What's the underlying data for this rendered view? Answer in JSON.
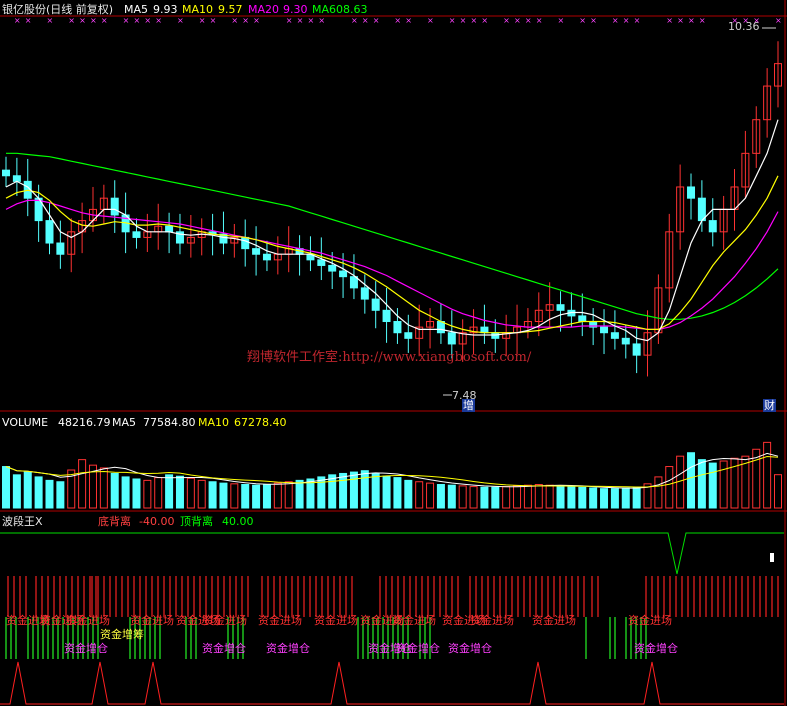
{
  "chart_data": [
    {
      "type": "candlestick",
      "panel": "price",
      "title": "银亿股份(日线 前复权)",
      "indicators": [
        {
          "name": "MA5",
          "value": "9.93",
          "color": "#ffffff"
        },
        {
          "name": "MA10",
          "value": "9.57",
          "color": "#ffff00"
        },
        {
          "name": "MA20",
          "value": "9.30",
          "color": "#ff00ff"
        },
        {
          "name": "MA60",
          "value": "8.63",
          "color": "#00ff00"
        }
      ],
      "annotations": {
        "high": "10.36",
        "low": "7.48",
        "low_marker": "增",
        "right_marker": "财"
      },
      "watermark": "翔博软件工作室:http://www.xiangbosoft.com/",
      "ylim": [
        7.3,
        10.6
      ],
      "closes": [
        9.3,
        9.25,
        9.1,
        8.9,
        8.7,
        8.6,
        8.8,
        8.9,
        9.0,
        9.1,
        8.95,
        8.8,
        8.75,
        8.8,
        8.85,
        8.8,
        8.7,
        8.75,
        8.8,
        8.78,
        8.7,
        8.75,
        8.65,
        8.6,
        8.55,
        8.6,
        8.65,
        8.6,
        8.55,
        8.5,
        8.45,
        8.4,
        8.3,
        8.2,
        8.1,
        8.0,
        7.9,
        7.85,
        7.95,
        8.0,
        7.9,
        7.8,
        7.9,
        7.95,
        7.9,
        7.85,
        7.9,
        7.95,
        8.0,
        8.1,
        8.15,
        8.1,
        8.05,
        8.0,
        7.95,
        7.9,
        7.85,
        7.8,
        7.7,
        7.9,
        8.3,
        8.8,
        9.2,
        9.1,
        8.9,
        8.8,
        9.0,
        9.2,
        9.5,
        9.8,
        10.1,
        10.3
      ],
      "ma5": [
        9.2,
        9.25,
        9.2,
        9.1,
        8.95,
        8.8,
        8.75,
        8.8,
        8.9,
        9.0,
        9.0,
        8.95,
        8.85,
        8.8,
        8.8,
        8.8,
        8.78,
        8.77,
        8.78,
        8.77,
        8.75,
        8.74,
        8.72,
        8.68,
        8.63,
        8.6,
        8.6,
        8.6,
        8.6,
        8.56,
        8.52,
        8.47,
        8.41,
        8.33,
        8.25,
        8.15,
        8.05,
        7.97,
        7.93,
        7.93,
        7.93,
        7.91,
        7.89,
        7.88,
        7.88,
        7.88,
        7.89,
        7.9,
        7.92,
        7.96,
        8.02,
        8.06,
        8.08,
        8.08,
        8.06,
        8.01,
        7.96,
        7.92,
        7.85,
        7.83,
        7.9,
        8.1,
        8.4,
        8.7,
        8.9,
        9.0,
        9.0,
        9.0,
        9.1,
        9.3,
        9.5,
        9.8
      ],
      "ma10": [
        9.1,
        9.15,
        9.17,
        9.15,
        9.08,
        8.98,
        8.9,
        8.86,
        8.85,
        8.87,
        8.89,
        8.88,
        8.86,
        8.86,
        8.87,
        8.86,
        8.84,
        8.82,
        8.8,
        8.78,
        8.77,
        8.76,
        8.75,
        8.73,
        8.7,
        8.67,
        8.65,
        8.63,
        8.61,
        8.58,
        8.55,
        8.52,
        8.48,
        8.43,
        8.37,
        8.31,
        8.24,
        8.17,
        8.1,
        8.05,
        8.0,
        7.96,
        7.93,
        7.91,
        7.9,
        7.9,
        7.9,
        7.9,
        7.91,
        7.92,
        7.94,
        7.96,
        7.98,
        8.0,
        8.0,
        8.0,
        7.99,
        7.97,
        7.95,
        7.93,
        7.93,
        7.98,
        8.08,
        8.2,
        8.35,
        8.5,
        8.62,
        8.72,
        8.82,
        8.95,
        9.1,
        9.3
      ],
      "ma20": [
        9.0,
        9.05,
        9.08,
        9.08,
        9.06,
        9.03,
        9.0,
        8.97,
        8.95,
        8.94,
        8.93,
        8.92,
        8.91,
        8.9,
        8.89,
        8.88,
        8.87,
        8.85,
        8.83,
        8.81,
        8.79,
        8.77,
        8.75,
        8.73,
        8.71,
        8.69,
        8.67,
        8.65,
        8.63,
        8.61,
        8.58,
        8.55,
        8.52,
        8.49,
        8.45,
        8.41,
        8.36,
        8.31,
        8.26,
        8.21,
        8.16,
        8.11,
        8.07,
        8.04,
        8.01,
        7.99,
        7.97,
        7.96,
        7.95,
        7.95,
        7.95,
        7.95,
        7.95,
        7.96,
        7.96,
        7.96,
        7.96,
        7.95,
        7.94,
        7.93,
        7.93,
        7.95,
        7.99,
        8.05,
        8.12,
        8.2,
        8.3,
        8.4,
        8.52,
        8.65,
        8.8,
        8.98
      ],
      "ma60": [
        9.5,
        9.5,
        9.49,
        9.48,
        9.47,
        9.45,
        9.43,
        9.41,
        9.39,
        9.37,
        9.35,
        9.33,
        9.31,
        9.29,
        9.27,
        9.25,
        9.23,
        9.21,
        9.19,
        9.17,
        9.15,
        9.13,
        9.11,
        9.09,
        9.07,
        9.05,
        9.03,
        9.0,
        8.97,
        8.94,
        8.91,
        8.88,
        8.85,
        8.82,
        8.79,
        8.76,
        8.73,
        8.7,
        8.67,
        8.64,
        8.61,
        8.58,
        8.55,
        8.52,
        8.49,
        8.46,
        8.43,
        8.4,
        8.37,
        8.34,
        8.31,
        8.28,
        8.25,
        8.22,
        8.19,
        8.16,
        8.13,
        8.1,
        8.07,
        8.05,
        8.03,
        8.02,
        8.02,
        8.03,
        8.05,
        8.08,
        8.12,
        8.17,
        8.23,
        8.3,
        8.38,
        8.47
      ]
    },
    {
      "type": "bar",
      "panel": "volume",
      "indicators": [
        {
          "name": "VOLUME",
          "value": "48216.79",
          "color": "#ffffff"
        },
        {
          "name": "MA5",
          "value": "77584.80",
          "color": "#ffffff"
        },
        {
          "name": "MA10",
          "value": "67278.40",
          "color": "#ffff00"
        }
      ],
      "ylim": [
        0,
        110000
      ],
      "values": [
        60000,
        48000,
        52000,
        45000,
        40000,
        38000,
        55000,
        70000,
        62000,
        58000,
        50000,
        45000,
        42000,
        40000,
        44000,
        48000,
        46000,
        43000,
        40000,
        38000,
        36000,
        35000,
        34000,
        33000,
        34000,
        36000,
        38000,
        40000,
        42000,
        45000,
        48000,
        50000,
        52000,
        54000,
        50000,
        46000,
        44000,
        40000,
        38000,
        36000,
        34000,
        33000,
        32000,
        31000,
        30000,
        30000,
        31000,
        32000,
        33000,
        34000,
        33000,
        32000,
        31000,
        30000,
        29000,
        28000,
        28000,
        29000,
        30000,
        35000,
        45000,
        60000,
        75000,
        80000,
        70000,
        65000,
        68000,
        72000,
        75000,
        85000,
        95000,
        48216.79
      ]
    },
    {
      "type": "signal",
      "panel": "indicator",
      "title": "波段王X",
      "indicators": [
        {
          "name": "底背离",
          "value": "-40.00",
          "color": "#ff4040"
        },
        {
          "name": "顶背离",
          "value": "40.00",
          "color": "#00ff00"
        }
      ],
      "red_labels": [
        "资金进场",
        "资金进场",
        "资金进场",
        "资金进场",
        "资金进场",
        "资金进场",
        "资金进场",
        "资金进场",
        "资金进场",
        "资金进场",
        "资金进场",
        "资金进场",
        "资金进场",
        "资金进场"
      ],
      "yellow_labels": [
        "资金增筹"
      ],
      "magenta_labels": [
        "资金增仓",
        "资金增仓",
        "资金增仓",
        "资金增仓",
        "资金增仓",
        "资金增仓",
        "资金增仓"
      ]
    }
  ]
}
